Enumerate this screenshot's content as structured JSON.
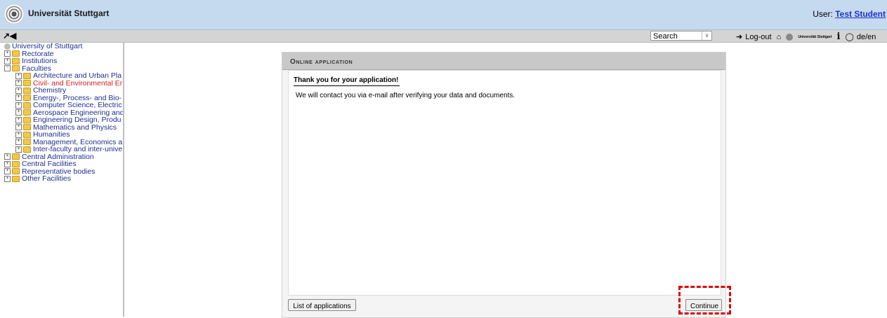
{
  "header": {
    "title": "Universität Stuttgart",
    "user_prefix": "User:",
    "user_name": "Test Student"
  },
  "toolbar": {
    "left_icons": "↗◀",
    "search_value": "Search",
    "logout_label": "Log-out",
    "mini_logo_text": "Universität Stuttgart",
    "lang_label": "de/en"
  },
  "sidebar": {
    "root": "University of Stuttgart",
    "items": [
      {
        "label": "Rectorate",
        "level": 1,
        "toggle": "+"
      },
      {
        "label": "Institutions",
        "level": 1,
        "toggle": "+"
      },
      {
        "label": "Faculties",
        "level": 1,
        "toggle": "−"
      },
      {
        "label": "Architecture and Urban Pla",
        "level": 2,
        "toggle": "+"
      },
      {
        "label": "Civil- and Environmental Er",
        "level": 2,
        "toggle": "+",
        "active": true
      },
      {
        "label": "Chemistry",
        "level": 2,
        "toggle": "+"
      },
      {
        "label": "Energy-, Process- and Bio-",
        "level": 2,
        "toggle": "+"
      },
      {
        "label": "Computer Science, Electric",
        "level": 2,
        "toggle": "+"
      },
      {
        "label": "Aerospace Engineering and",
        "level": 2,
        "toggle": "+"
      },
      {
        "label": "Engineering Design, Produ",
        "level": 2,
        "toggle": "+"
      },
      {
        "label": "Mathematics and Physics",
        "level": 2,
        "toggle": "+"
      },
      {
        "label": "Humanities",
        "level": 2,
        "toggle": "+"
      },
      {
        "label": "Management, Economics a",
        "level": 2,
        "toggle": "+"
      },
      {
        "label": "Inter-faculty and inter-unive",
        "level": 2,
        "toggle": "+"
      },
      {
        "label": "Central Administration",
        "level": 1,
        "toggle": "+"
      },
      {
        "label": "Central Facilities",
        "level": 1,
        "toggle": "+"
      },
      {
        "label": "Representative bodies",
        "level": 1,
        "toggle": "+"
      },
      {
        "label": "Other Facilities",
        "level": 1,
        "toggle": "+"
      }
    ]
  },
  "main": {
    "panel_title": "Online application",
    "thanks_heading": "Thank you for your application!",
    "contact_message": "We will contact you via e-mail after verifying your data and documents.",
    "list_button": "List of applications",
    "continue_button": "Continue"
  },
  "colors": {
    "header_bg": "#c5d9ef",
    "highlight": "#e00000",
    "active_link": "#d62020",
    "link": "#1f2f8f"
  }
}
